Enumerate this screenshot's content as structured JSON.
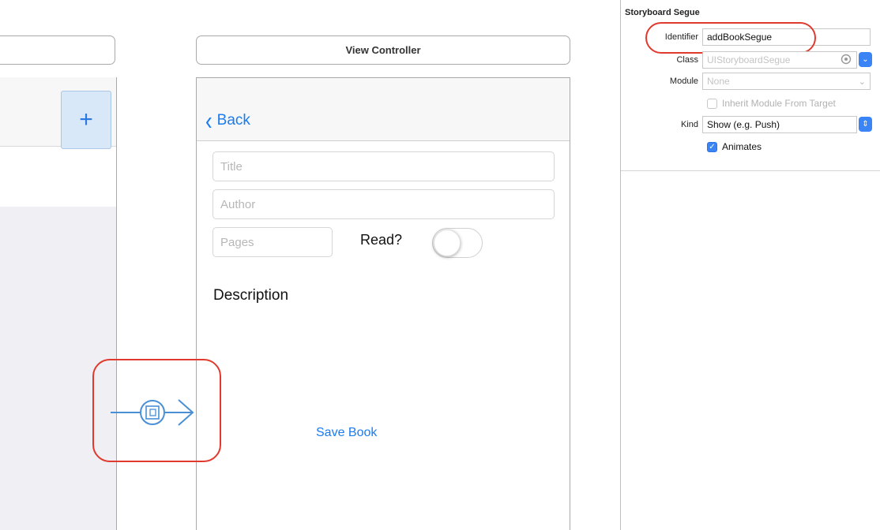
{
  "view_controller": {
    "title": "View Controller",
    "back_label": "Back",
    "fields": {
      "title_placeholder": "Title",
      "author_placeholder": "Author",
      "pages_placeholder": "Pages"
    },
    "read_label": "Read?",
    "read_toggle_on": false,
    "description_label": "Description",
    "save_button_label": "Save Book"
  },
  "previous_scene": {
    "add_button_label": "+"
  },
  "inspector": {
    "section_title": "Storyboard Segue",
    "identifier_label": "Identifier",
    "identifier_value": "addBookSegue",
    "class_label": "Class",
    "class_placeholder": "UIStoryboardSegue",
    "module_label": "Module",
    "module_placeholder": "None",
    "inherit_label": "Inherit Module From Target",
    "inherit_checked": false,
    "kind_label": "Kind",
    "kind_value": "Show (e.g. Push)",
    "animates_label": "Animates",
    "animates_checked": true
  },
  "colors": {
    "accent_blue": "#1a7cf0",
    "annotation_red": "#e03a2e",
    "segue_blue": "#4a8fd6"
  },
  "icons": {
    "back": "chevron-left-icon",
    "segue": "segue-push-icon"
  }
}
